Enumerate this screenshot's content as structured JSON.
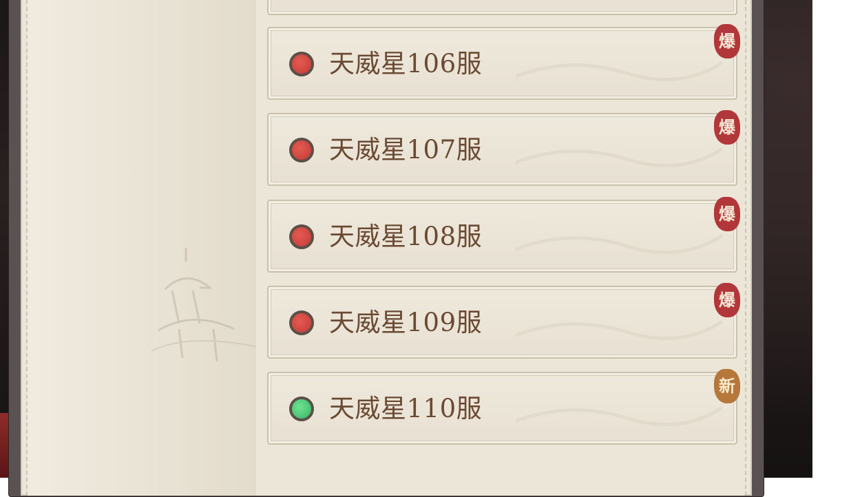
{
  "servers": [
    {
      "name": "天威星106服",
      "status": "hot",
      "status_color": "#d34840",
      "badge": "爆"
    },
    {
      "name": "天威星107服",
      "status": "hot",
      "status_color": "#d34840",
      "badge": "爆"
    },
    {
      "name": "天威星108服",
      "status": "hot",
      "status_color": "#d34840",
      "badge": "爆"
    },
    {
      "name": "天威星109服",
      "status": "hot",
      "status_color": "#d34840",
      "badge": "爆"
    },
    {
      "name": "天威星110服",
      "status": "new",
      "status_color": "#4ccc78",
      "badge": "新"
    }
  ],
  "colors": {
    "panel_bg": "#ece6da",
    "text": "#6b4a34",
    "hot_badge": "#b2373a",
    "new_badge": "#b5773a"
  }
}
